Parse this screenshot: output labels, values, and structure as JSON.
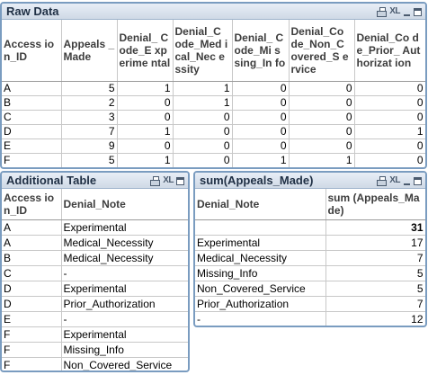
{
  "raw_data": {
    "title": "Raw Data",
    "xl_label": "XL",
    "headers": [
      "Access ion_ID",
      "Appeals _Made",
      "Denial_ Code_E xperime ntal",
      "Denial_C ode_Med ical_Nec essity",
      "Denial_ Code_Mi ssing_In fo",
      "Denial_Co de_Non_C overed_S ervice",
      "Denial_Co de_Prior_ Authorizat ion"
    ],
    "rows": [
      [
        "A",
        "5",
        "1",
        "1",
        "0",
        "0",
        "0"
      ],
      [
        "B",
        "2",
        "0",
        "1",
        "0",
        "0",
        "0"
      ],
      [
        "C",
        "3",
        "0",
        "0",
        "0",
        "0",
        "0"
      ],
      [
        "D",
        "7",
        "1",
        "0",
        "0",
        "0",
        "1"
      ],
      [
        "E",
        "9",
        "0",
        "0",
        "0",
        "0",
        "0"
      ],
      [
        "F",
        "5",
        "1",
        "0",
        "1",
        "1",
        "0"
      ]
    ]
  },
  "additional_table": {
    "title": "Additional Table",
    "xl_label": "XL",
    "headers": [
      "Access ion_ID",
      "Denial_Note"
    ],
    "rows": [
      [
        "A",
        "Experimental"
      ],
      [
        "A",
        "Medical_Necessity"
      ],
      [
        "B",
        "Medical_Necessity"
      ],
      [
        "C",
        "-"
      ],
      [
        "D",
        "Experimental"
      ],
      [
        "D",
        "Prior_Authorization"
      ],
      [
        "E",
        "-"
      ],
      [
        "F",
        "Experimental"
      ],
      [
        "F",
        "Missing_Info"
      ],
      [
        "F",
        "Non_Covered_Service"
      ]
    ]
  },
  "sum_table": {
    "title": "sum(Appeals_Made)",
    "xl_label": "XL",
    "headers": [
      "Denial_Note",
      "sum (Appeals_Made)"
    ],
    "total": [
      "",
      "31"
    ],
    "rows": [
      [
        "Experimental",
        "17"
      ],
      [
        "Medical_Necessity",
        "7"
      ],
      [
        "Missing_Info",
        "5"
      ],
      [
        "Non_Covered_Service",
        "5"
      ],
      [
        "Prior_Authorization",
        "7"
      ],
      [
        "-",
        "12"
      ]
    ]
  }
}
